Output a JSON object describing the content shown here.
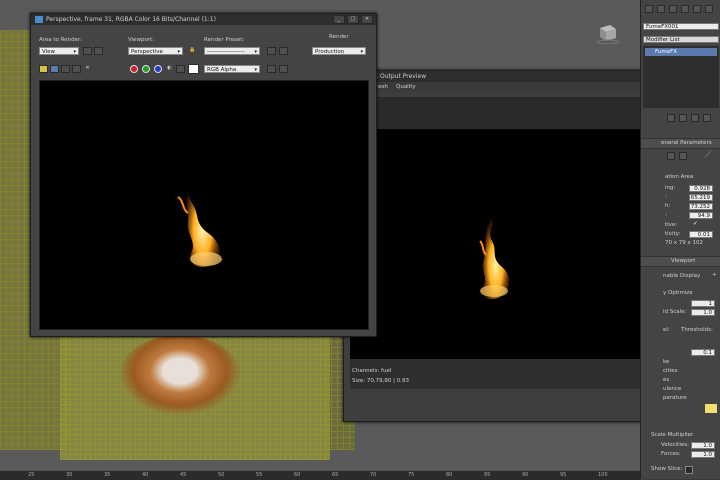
{
  "render_window": {
    "title": "Perspective, frame 31, RGBA Color 16 Bits/Channel (1:1)",
    "area_label": "Area to Render:",
    "area_value": "View",
    "viewport_label": "Viewport:",
    "viewport_value": "Perspective",
    "preset_label": "Render Preset:",
    "preset_value": "-------------------",
    "render_label": "Render",
    "render_mode": "Production",
    "channel_value": "RGB Alpha",
    "min_glyph": "_",
    "max_glyph": "□",
    "close_glyph": "✕"
  },
  "output_preview": {
    "title": "X Output Preview",
    "menu_refresh": "fresh",
    "menu_quality": "Quality",
    "channels": "Channels: fuel",
    "size": "Size: 70,79,80 | 0.93",
    "close_glyph": "✕"
  },
  "panel": {
    "object_name": "FumeFX001",
    "modifier_list": "Modifier List",
    "stack_item": "FumeFX",
    "rollout_general": "eneral Parameters",
    "sim_area": "ation Area",
    "spacing_label": "ing:",
    "spacing_value": "0.928",
    "width_label": ":",
    "width_value": "65.219",
    "length_label": "h:",
    "length_value": "73.252",
    "height_label": ":",
    "height_value": "94.9",
    "adaptive_label": "tive:",
    "adaptive_check": "✔",
    "sensitivity_label": "tivity:",
    "sensitivity_value": "0.01",
    "grid_dims": "70 x 79 x 102",
    "rollout_viewport": "Viewport",
    "display_label": "nable Display",
    "plus_glyph": "+",
    "optimize_label": "y Optimize",
    "optimize_value": "1",
    "scale_label": "ld Scale:",
    "scale_value": "1.0",
    "channel_label": "el:",
    "thresholds_label": "Thresholds:",
    "fuel_value": "0.1",
    "rows": [
      "ke",
      "cities",
      "es",
      "ulence",
      "perature"
    ],
    "scale_multiplier": "Scale Multiplier",
    "velocities_label": "Velocities:",
    "velocities_value": "1.0",
    "forces_label": "Forces:",
    "forces_value": "1.0",
    "show_slice": "Show Slice:"
  },
  "ruler_ticks": [
    "25",
    "30",
    "35",
    "40",
    "45",
    "50",
    "55",
    "60",
    "65",
    "70",
    "75",
    "80",
    "85",
    "90",
    "95",
    "100"
  ]
}
